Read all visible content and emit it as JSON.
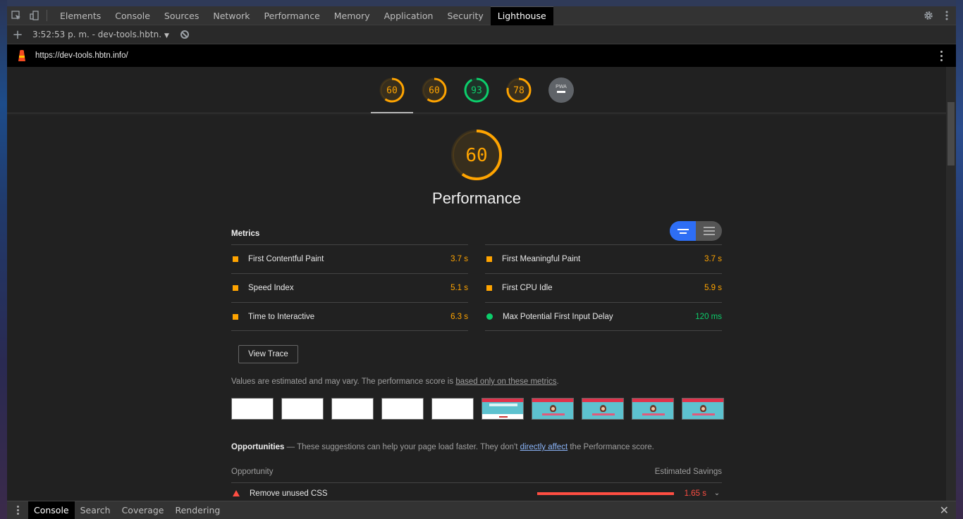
{
  "toolbar": {
    "tabs": [
      "Elements",
      "Console",
      "Sources",
      "Network",
      "Performance",
      "Memory",
      "Application",
      "Security",
      "Lighthouse"
    ],
    "active_tab": "Lighthouse"
  },
  "subbar": {
    "session": "3:52:53 p. m. - dev-tools.hbtn."
  },
  "urlbar": {
    "url": "https://dev-tools.hbtn.info/"
  },
  "gauges": [
    {
      "score": "60",
      "color": "#ffa400",
      "value": 0.6
    },
    {
      "score": "60",
      "color": "#ffa400",
      "value": 0.6
    },
    {
      "score": "93",
      "color": "#0cce6b",
      "value": 0.93
    },
    {
      "score": "78",
      "color": "#ffa400",
      "value": 0.78
    },
    {
      "score": "PWA",
      "color": "#5f6368",
      "value": 0
    }
  ],
  "performance": {
    "score": "60",
    "score_value": 0.6,
    "title": "Performance",
    "metrics_label": "Metrics",
    "metrics_left": [
      {
        "name": "First Contentful Paint",
        "value": "3.7 s",
        "status": "average"
      },
      {
        "name": "Speed Index",
        "value": "5.1 s",
        "status": "average"
      },
      {
        "name": "Time to Interactive",
        "value": "6.3 s",
        "status": "average"
      }
    ],
    "metrics_right": [
      {
        "name": "First Meaningful Paint",
        "value": "3.7 s",
        "status": "average"
      },
      {
        "name": "First CPU Idle",
        "value": "5.9 s",
        "status": "average"
      },
      {
        "name": "Max Potential First Input Delay",
        "value": "120 ms",
        "status": "pass"
      }
    ],
    "view_trace": "View Trace",
    "estimate_text": "Values are estimated and may vary. The performance score is ",
    "estimate_link": "based only on these metrics",
    "estimate_end": ".",
    "filmstrip_frames": [
      "blank",
      "blank",
      "blank",
      "blank",
      "blank",
      "first",
      "loaded",
      "loaded",
      "loaded",
      "loaded"
    ]
  },
  "opportunities": {
    "title": "Opportunities",
    "dash": " — ",
    "desc": "These suggestions can help your page load faster. They don't ",
    "link": "directly affect",
    "desc_end": " the Performance score.",
    "col_opportunity": "Opportunity",
    "col_savings": "Estimated Savings",
    "rows": [
      {
        "name": "Remove unused CSS",
        "savings": "1.65 s"
      }
    ]
  },
  "drawer": {
    "tabs": [
      "Console",
      "Search",
      "Coverage",
      "Rendering"
    ],
    "active": "Console"
  },
  "colors": {
    "average": "#ffa400",
    "pass": "#0cce6b",
    "fail": "#ff4e42",
    "accent": "#2e6ef5"
  }
}
